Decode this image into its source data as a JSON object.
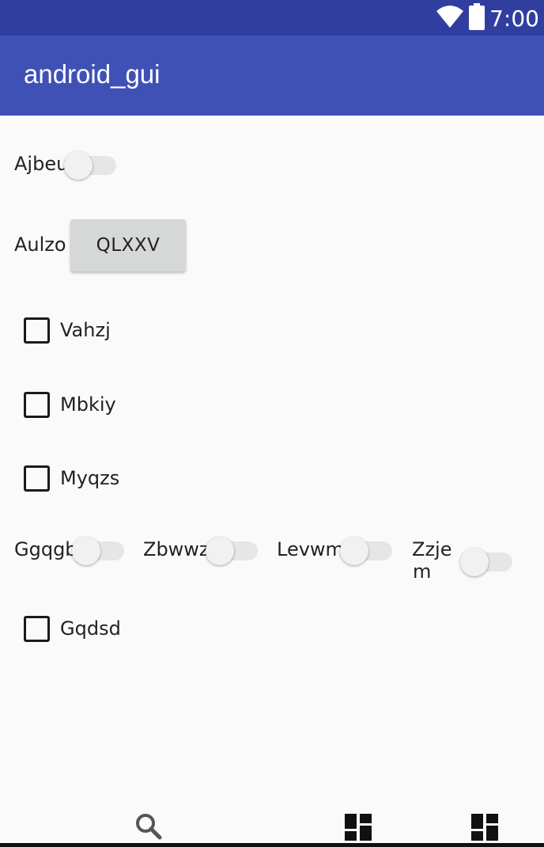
{
  "status_bar": {
    "time": "7:00",
    "icons": [
      "wifi-icon",
      "battery-icon"
    ]
  },
  "app_bar": {
    "title": "android_gui"
  },
  "content": {
    "switch_ajbeu": {
      "label": "Ajbeu",
      "checked": false
    },
    "button_row": {
      "label": "Aulzo",
      "button_label": "QLXXV"
    },
    "checkboxes": [
      {
        "label": "Vahzj",
        "checked": false
      },
      {
        "label": "Mbkiy",
        "checked": false
      },
      {
        "label": "Myqzs",
        "checked": false
      }
    ],
    "switch_row": [
      {
        "label": "Ggqgb",
        "checked": false
      },
      {
        "label": "Zbwwz",
        "checked": false
      },
      {
        "label": "Levwm",
        "checked": false
      },
      {
        "label_line1": "Zzje",
        "label_line2": "m",
        "checked": false
      }
    ],
    "checkbox_last": {
      "label": "Gqdsd",
      "checked": false
    }
  },
  "bottom_nav": {
    "icons": [
      "search-icon",
      "dashboard-icon",
      "dashboard-icon"
    ]
  },
  "colors": {
    "status_bar": "#303f9f",
    "app_bar": "#3f51b5",
    "background": "#fafafa"
  }
}
